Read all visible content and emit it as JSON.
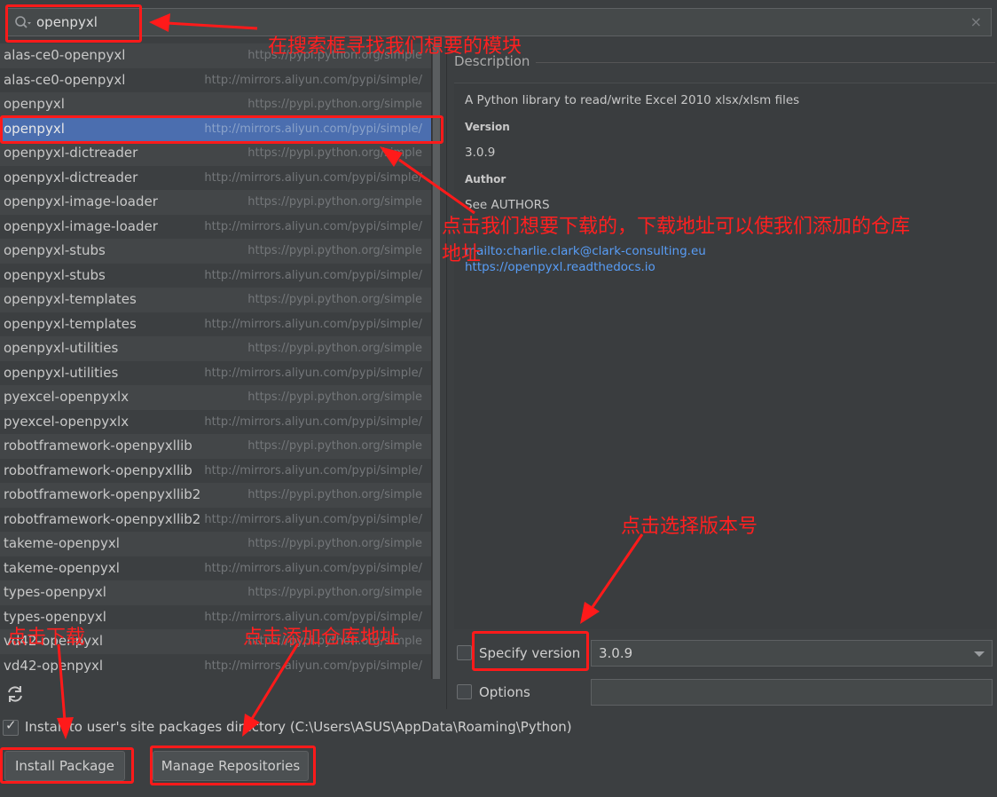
{
  "search": {
    "value": "openpyxl",
    "clear_glyph": "×",
    "icon": "search-icon"
  },
  "packages": [
    {
      "name": "alas-ce0-openpyxl",
      "repo": "https://pypi.python.org/simple"
    },
    {
      "name": "alas-ce0-openpyxl",
      "repo": "http://mirrors.aliyun.com/pypi/simple/"
    },
    {
      "name": "openpyxl",
      "repo": "https://pypi.python.org/simple"
    },
    {
      "name": "openpyxl",
      "repo": "http://mirrors.aliyun.com/pypi/simple/",
      "selected": true
    },
    {
      "name": "openpyxl-dictreader",
      "repo": "https://pypi.python.org/simple"
    },
    {
      "name": "openpyxl-dictreader",
      "repo": "http://mirrors.aliyun.com/pypi/simple/"
    },
    {
      "name": "openpyxl-image-loader",
      "repo": "https://pypi.python.org/simple"
    },
    {
      "name": "openpyxl-image-loader",
      "repo": "http://mirrors.aliyun.com/pypi/simple/"
    },
    {
      "name": "openpyxl-stubs",
      "repo": "https://pypi.python.org/simple"
    },
    {
      "name": "openpyxl-stubs",
      "repo": "http://mirrors.aliyun.com/pypi/simple/"
    },
    {
      "name": "openpyxl-templates",
      "repo": "https://pypi.python.org/simple"
    },
    {
      "name": "openpyxl-templates",
      "repo": "http://mirrors.aliyun.com/pypi/simple/"
    },
    {
      "name": "openpyxl-utilities",
      "repo": "https://pypi.python.org/simple"
    },
    {
      "name": "openpyxl-utilities",
      "repo": "http://mirrors.aliyun.com/pypi/simple/"
    },
    {
      "name": "pyexcel-openpyxlx",
      "repo": "https://pypi.python.org/simple"
    },
    {
      "name": "pyexcel-openpyxlx",
      "repo": "http://mirrors.aliyun.com/pypi/simple/"
    },
    {
      "name": "robotframework-openpyxllib",
      "repo": "https://pypi.python.org/simple"
    },
    {
      "name": "robotframework-openpyxllib",
      "repo": "http://mirrors.aliyun.com/pypi/simple/"
    },
    {
      "name": "robotframework-openpyxllib2",
      "repo": "https://pypi.python.org/simple"
    },
    {
      "name": "robotframework-openpyxllib2",
      "repo": "http://mirrors.aliyun.com/pypi/simple/"
    },
    {
      "name": "takeme-openpyxl",
      "repo": "https://pypi.python.org/simple"
    },
    {
      "name": "takeme-openpyxl",
      "repo": "http://mirrors.aliyun.com/pypi/simple/"
    },
    {
      "name": "types-openpyxl",
      "repo": "https://pypi.python.org/simple"
    },
    {
      "name": "types-openpyxl",
      "repo": "http://mirrors.aliyun.com/pypi/simple/"
    },
    {
      "name": "vd42-openpyxl",
      "repo": "https://pypi.python.org/simple"
    },
    {
      "name": "vd42-openpyxl",
      "repo": "http://mirrors.aliyun.com/pypi/simple/"
    }
  ],
  "description": {
    "header": "Description",
    "summary": "A Python library to read/write Excel 2010 xlsx/xlsm files",
    "version_label": "Version",
    "version_value": "3.0.9",
    "author_label": "Author",
    "author_value": "See AUTHORS",
    "link_mail": "mailto:charlie.clark@clark-consulting.eu",
    "link_docs": "https://openpyxl.readthedocs.io"
  },
  "specify_version": {
    "label": "Specify version",
    "value": "3.0.9",
    "checked": false
  },
  "options": {
    "label": "Options",
    "value": "",
    "checked": false
  },
  "install_to_user": {
    "label": "Install to user's site packages directory (C:\\Users\\ASUS\\AppData\\Roaming\\Python)",
    "checked": true,
    "glyph": "✓"
  },
  "buttons": {
    "install": "Install Package",
    "manage": "Manage Repositories"
  },
  "annotations": {
    "search": "在搜索框寻找我们想要的模块",
    "select": "点击我们想要下载的，下载地址可以使我们添加的仓库地址",
    "select_line1": "点击我们想要下载的，下载地址可以使我们添加的仓库",
    "select_line2": "地址",
    "version": "点击选择版本号",
    "install": "点击下载",
    "manage": "点击添加仓库地址"
  },
  "colors": {
    "accent_selected": "#4b6eaf",
    "annotation_red": "#ff1a1a",
    "link": "#589df6"
  }
}
